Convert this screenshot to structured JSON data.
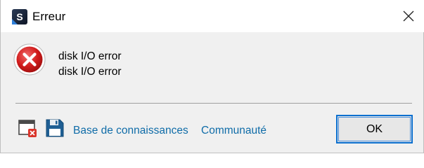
{
  "window": {
    "title": "Erreur",
    "app_icon": "app-logo-icon",
    "close_icon": "close-icon"
  },
  "message": {
    "icon": "error-icon",
    "lines": [
      "disk I/O error",
      "disk I/O error"
    ]
  },
  "footer": {
    "icons": [
      "window-error-icon",
      "save-icon"
    ],
    "links": [
      "Base de connaissances",
      "Communauté"
    ],
    "ok_label": "OK"
  },
  "colors": {
    "link": "#0f6ca8",
    "error_red": "#c8102e",
    "button_focus": "#0a6fcf"
  }
}
